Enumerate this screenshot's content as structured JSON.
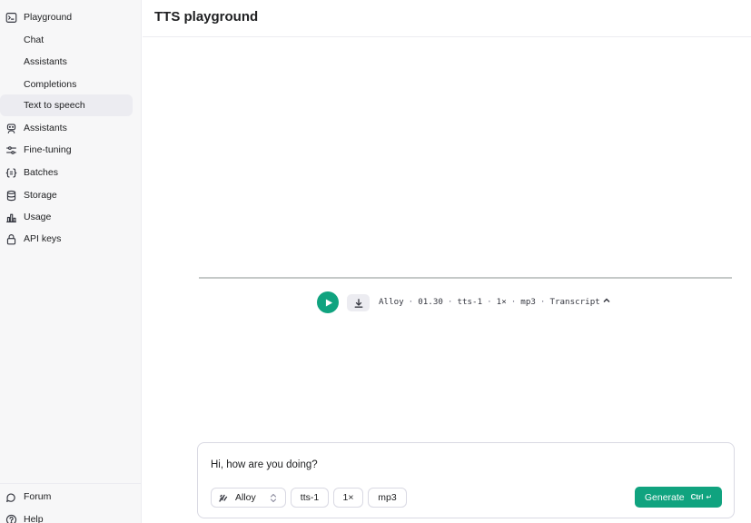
{
  "sidebar": {
    "playground": {
      "label": "Playground",
      "icon": "terminal-icon"
    },
    "sub_items": [
      {
        "label": "Chat"
      },
      {
        "label": "Assistants"
      },
      {
        "label": "Completions"
      },
      {
        "label": "Text to speech",
        "active": true
      }
    ],
    "items": [
      {
        "label": "Assistants",
        "icon": "robot-icon"
      },
      {
        "label": "Fine-tuning",
        "icon": "sliders-icon"
      },
      {
        "label": "Batches",
        "icon": "braces-icon"
      },
      {
        "label": "Storage",
        "icon": "database-icon"
      },
      {
        "label": "Usage",
        "icon": "bar-chart-icon"
      },
      {
        "label": "API keys",
        "icon": "lock-icon"
      }
    ],
    "footer": [
      {
        "label": "Forum",
        "icon": "forum-icon"
      },
      {
        "label": "Help",
        "icon": "help-icon"
      }
    ]
  },
  "header": {
    "title": "TTS playground"
  },
  "player": {
    "voice": "Alloy",
    "duration": "01.30",
    "model": "tts-1",
    "speed": "1×",
    "format": "mp3",
    "transcript_label": "Transcript",
    "separator": "·"
  },
  "composer": {
    "text": "Hi, how are you doing?",
    "voice": "Alloy",
    "model": "tts-1",
    "speed": "1×",
    "format": "mp3",
    "generate_label": "Generate",
    "shortcut": "Ctrl",
    "enter_glyph": "↵"
  },
  "colors": {
    "accent": "#10a37f",
    "sidebar_bg": "#f7f7f8",
    "active_bg": "#ececf1",
    "border": "#d9d9e3"
  }
}
